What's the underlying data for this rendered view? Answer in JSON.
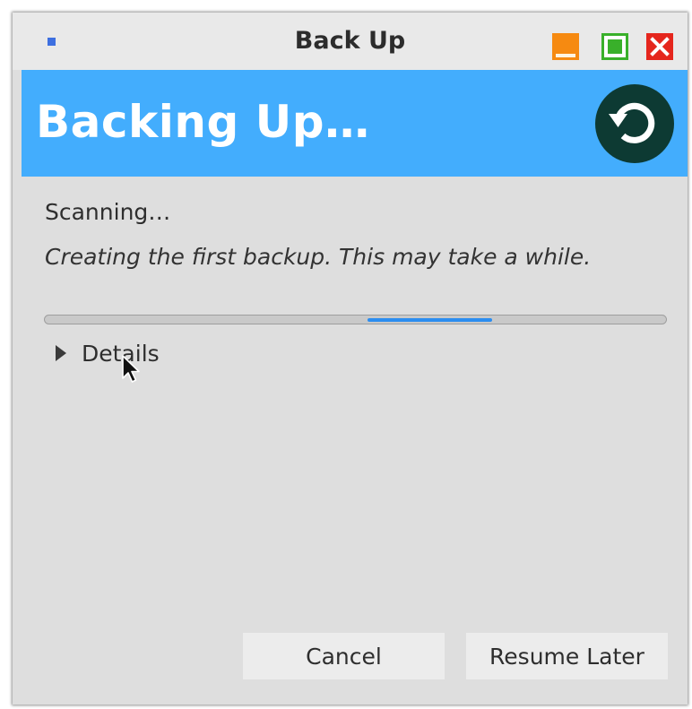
{
  "window": {
    "title": "Back Up",
    "title_icon": "app-dot-icon",
    "controls": [
      "minimize-icon",
      "maximize-icon",
      "close-icon"
    ]
  },
  "banner": {
    "title": "Backing Up…",
    "icon": "sync-icon",
    "color": "#43adfd"
  },
  "body": {
    "status": "Scanning…",
    "subtitle": "Creating the first backup.  This may take a while.",
    "progress": {
      "mode": "indeterminate",
      "indicator_start_fraction": 0.52,
      "indicator_end_fraction": 0.72,
      "color": "#2b8df0"
    },
    "details_label": "Details"
  },
  "buttons": {
    "cancel": "Cancel",
    "resume_later": "Resume Later"
  },
  "colors": {
    "minimize": "#f68a11",
    "maximize": "#39b02a",
    "close": "#e5261d",
    "sync_badge": "#0d3a33"
  }
}
